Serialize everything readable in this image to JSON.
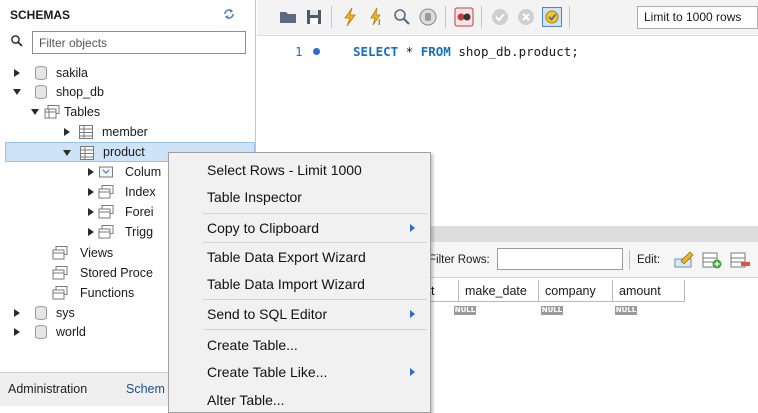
{
  "navigator": {
    "title": "SCHEMAS",
    "filter_placeholder": "Filter objects",
    "tree": {
      "sakila": "sakila",
      "shop_db": "shop_db",
      "tables": "Tables",
      "member": "member",
      "product": "product",
      "columns": "Colum",
      "indexes": "Index",
      "foreign_keys": "Forei",
      "triggers": "Trigg",
      "views": "Views",
      "stored_procedures": "Stored Proce",
      "functions": "Functions",
      "sys": "sys",
      "world": "world"
    },
    "bottom_tabs": {
      "administration": "Administration",
      "schemas": "Schem"
    }
  },
  "toolbar": {
    "limit_label": "Limit to 1000 rows"
  },
  "editor": {
    "line_number": "1",
    "sql": {
      "kw1": "SELECT",
      "star": " * ",
      "kw2": "FROM",
      "rest": " shop_db.product;"
    }
  },
  "result": {
    "filter_rows_label": "Filter Rows:",
    "edit_label": "Edit:",
    "columns": [
      "t",
      "make_date",
      "company",
      "amount"
    ],
    "null_label": "NULL"
  },
  "context_menu": {
    "items": [
      "Select Rows - Limit 1000",
      "Table Inspector",
      "Copy to Clipboard",
      "Table Data Export Wizard",
      "Table Data Import Wizard",
      "Send to SQL Editor",
      "Create Table...",
      "Create Table Like...",
      "Alter Table..."
    ]
  },
  "colors": {
    "selection": "#cfe3f8",
    "keyword": "#1570c4",
    "accent": "#2a6cd2"
  }
}
